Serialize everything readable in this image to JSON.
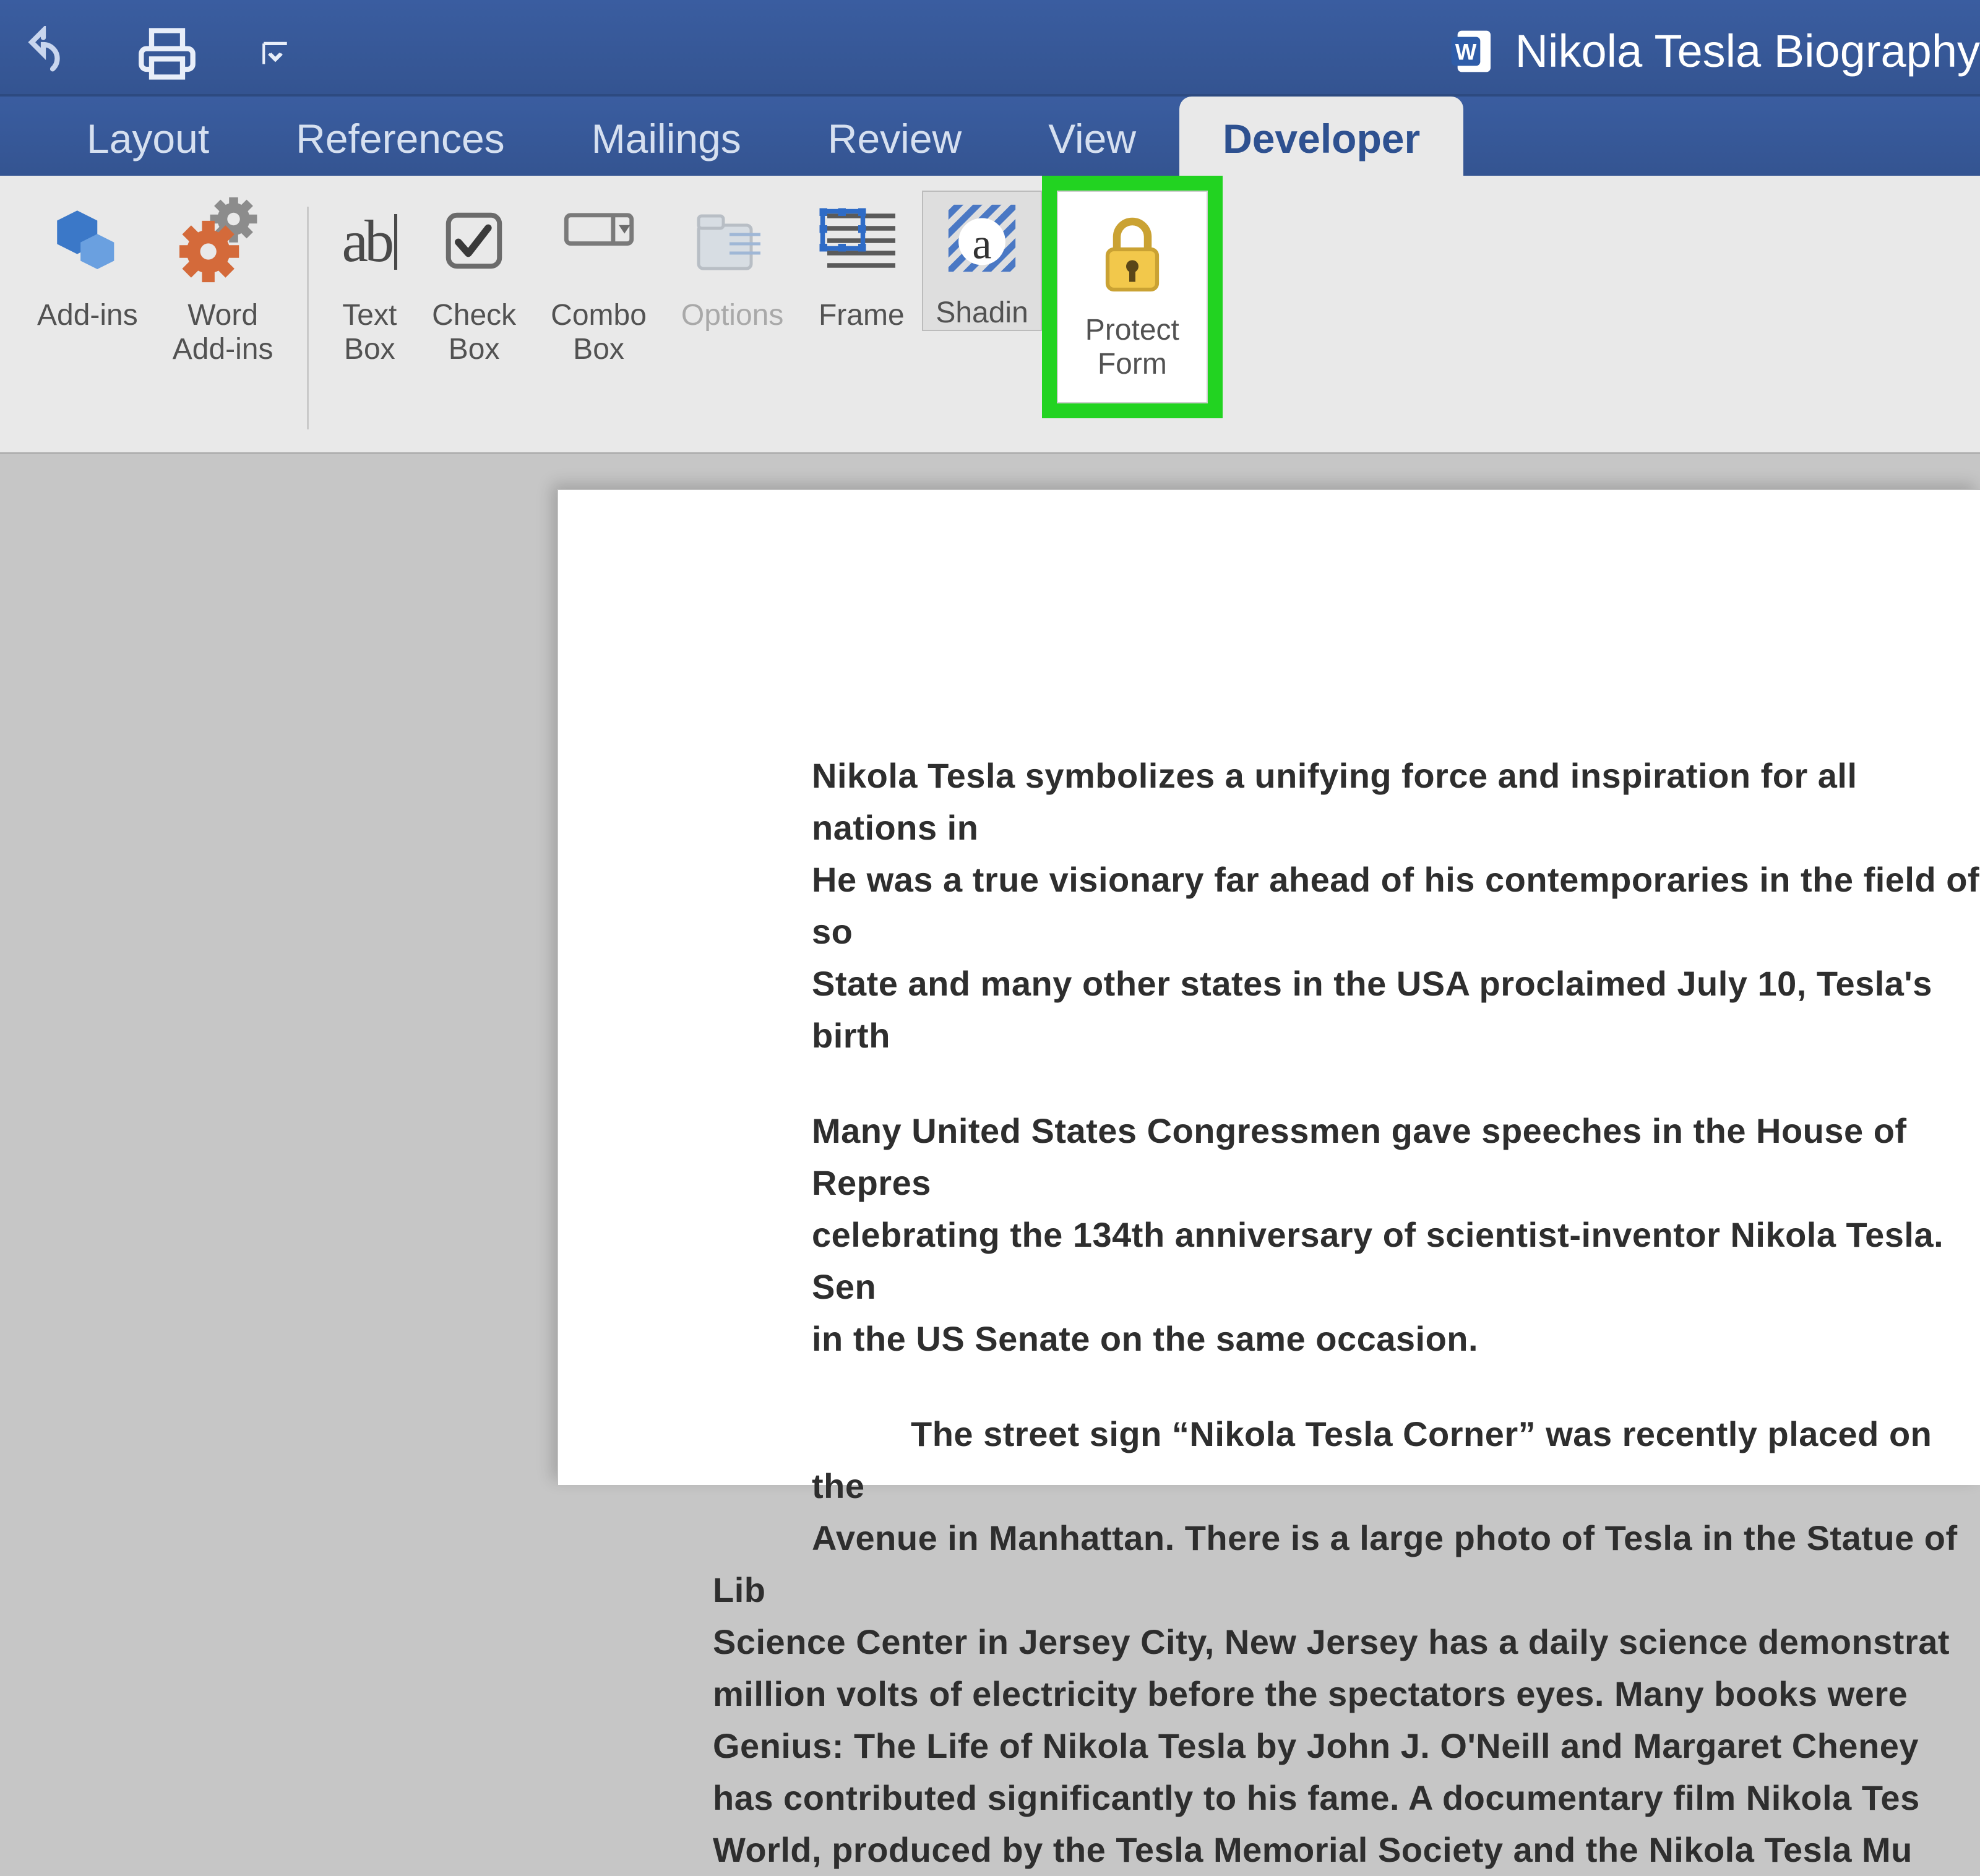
{
  "title": "Nikola Tesla Biography",
  "tabs": {
    "layout": "Layout",
    "references": "References",
    "mailings": "Mailings",
    "review": "Review",
    "view": "View",
    "developer": "Developer"
  },
  "ribbon": {
    "addins": "Add-ins",
    "word_addins": "Word\nAdd-ins",
    "text_box": "Text\nBox",
    "check_box": "Check\nBox",
    "combo_box": "Combo\nBox",
    "options": "Options",
    "frame": "Frame",
    "shading": "Shadin",
    "protect_form": "Protect\nForm"
  },
  "document": {
    "p1": "Nikola Tesla symbolizes a unifying force and inspiration for all nations in",
    "p2": "He was a true visionary far ahead of his contemporaries in the field of so",
    "p3": "State and many other states in the USA proclaimed July 10, Tesla's birth",
    "p4": "Many United States Congressmen gave speeches in the House of Repres",
    "p5": "celebrating the 134th anniversary of scientist-inventor Nikola Tesla. Sen",
    "p6": "in the US Senate on the same occasion.",
    "p7": "The street sign “Nikola Tesla Corner” was recently placed on the ",
    "p8": "Avenue in Manhattan. There is a large photo of Tesla in the Statue of Lib",
    "p9": "Science Center in Jersey City, New Jersey has a daily science demonstrat",
    "p10": "million volts of electricity before the spectators eyes. Many books were ",
    "p11": "Genius: The Life of Nikola Tesla by John J. O'Neill  and Margaret Cheney",
    "p12": "has contributed significantly to his fame. A documentary film Nikola Tes",
    "p13": "World, produced by the Tesla Memorial Society and the Nikola Tesla Mu"
  }
}
